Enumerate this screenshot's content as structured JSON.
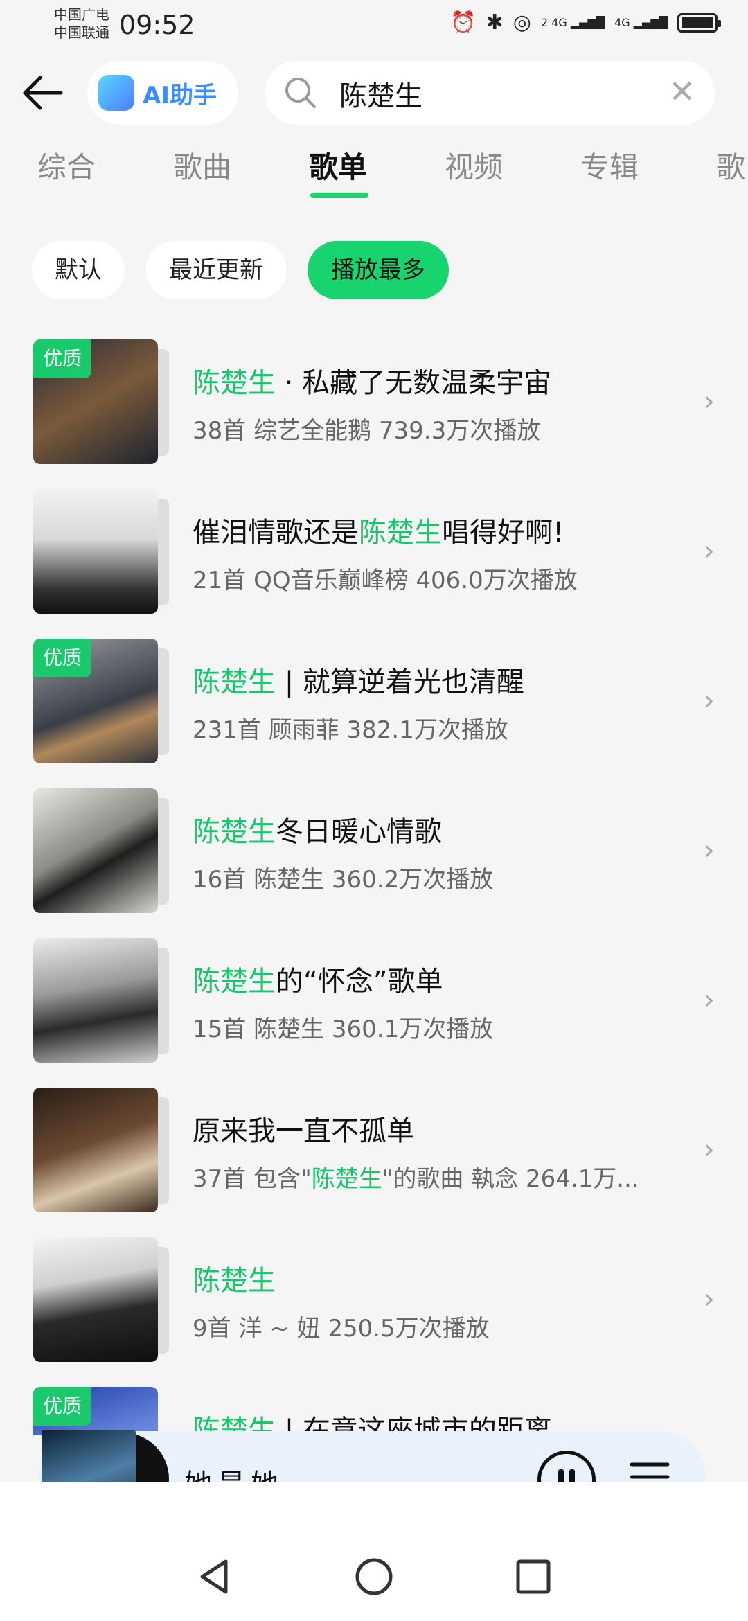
{
  "status_bar": {
    "carrier_1": "中国广电",
    "carrier_2": "中国联通",
    "time": "09:52",
    "signal_labels": [
      "2 4G",
      "4G"
    ]
  },
  "header": {
    "ai_label": "AI助手",
    "search_value": "陈楚生"
  },
  "tabs": [
    {
      "label": "综合"
    },
    {
      "label": "歌曲"
    },
    {
      "label": "歌单"
    },
    {
      "label": "视频"
    },
    {
      "label": "专辑"
    },
    {
      "label": "歌"
    }
  ],
  "active_tab": "歌单",
  "filters": [
    {
      "label": "默认"
    },
    {
      "label": "最近更新"
    },
    {
      "label": "播放最多"
    }
  ],
  "active_filter": "播放最多",
  "playlists": [
    {
      "badge": "优质",
      "title_prefix": "",
      "title_hl": "陈楚生",
      "title_rest": " · 私藏了无数温柔宇宙",
      "meta": "38首  综艺全能鹅  739.3万次播放"
    },
    {
      "badge": "",
      "title_prefix": "催泪情歌还是",
      "title_hl": "陈楚生",
      "title_rest": "唱得好啊!",
      "meta": "21首  QQ音乐巅峰榜  406.0万次播放"
    },
    {
      "badge": "优质",
      "title_prefix": "",
      "title_hl": "陈楚生",
      "title_rest": " | 就算逆着光也清醒",
      "meta": "231首  顾雨菲  382.1万次播放"
    },
    {
      "badge": "",
      "title_prefix": "",
      "title_hl": "陈楚生",
      "title_rest": "冬日暖心情歌",
      "meta": "16首  陈楚生  360.2万次播放"
    },
    {
      "badge": "",
      "title_prefix": "",
      "title_hl": "陈楚生",
      "title_rest": "的“怀念”歌单",
      "meta": "15首  陈楚生  360.1万次播放"
    },
    {
      "badge": "",
      "title_prefix": "原来我一直不孤单",
      "title_hl": "",
      "title_rest": "",
      "meta_prefix": "37首  包含\"",
      "meta_hl": "陈楚生",
      "meta_rest": "\"的歌曲 執念  264.1万..."
    },
    {
      "badge": "",
      "title_prefix": "",
      "title_hl": "陈楚生",
      "title_rest": "",
      "meta": "9首  洋 ~ 妞  250.5万次播放"
    },
    {
      "badge": "优质",
      "title_prefix": "",
      "title_hl": "陈楚生",
      "title_rest": " | 在意这座城市的距离",
      "meta": ""
    }
  ],
  "player": {
    "song": "她是她"
  },
  "colors": {
    "accent": "#19c56a",
    "chip_active": "#18d46e",
    "background": "#f5f5f5"
  }
}
